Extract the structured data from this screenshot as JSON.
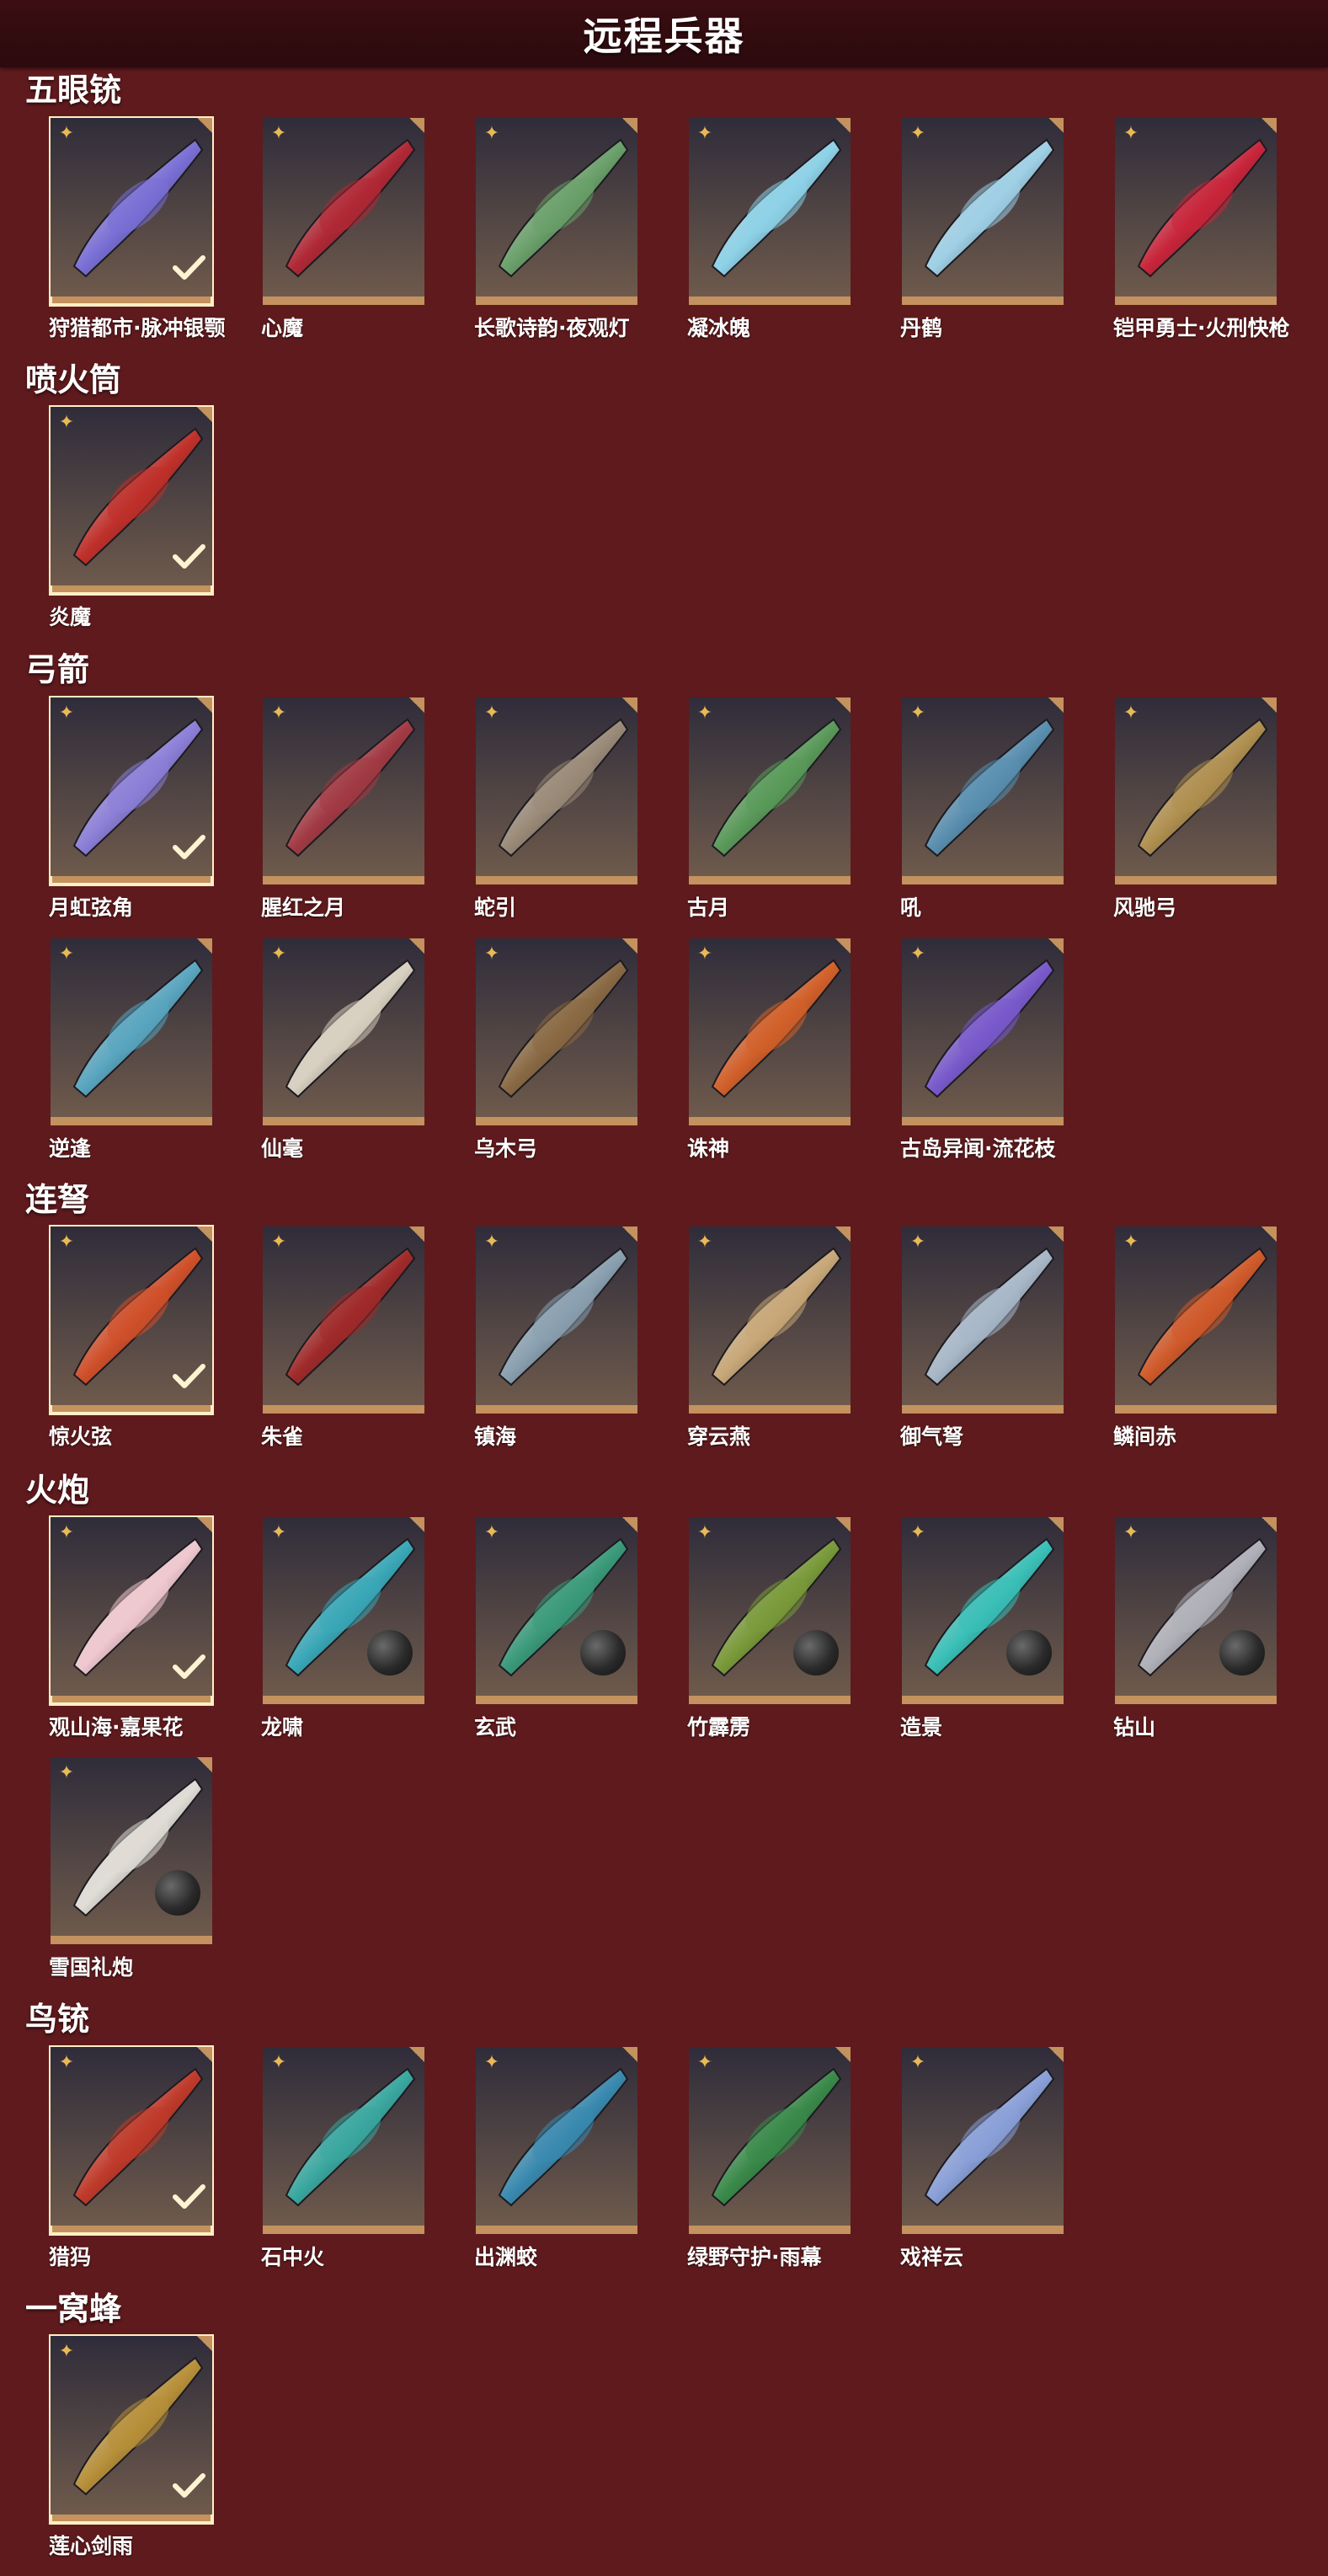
{
  "page": {
    "title": "远程兵器"
  },
  "colors": {
    "background": "#5f1a1d",
    "title_bar": "#2b0a0d",
    "card_bg": "#3c3340",
    "card_border": "#c3925e",
    "selected_outline": "#ffefc4",
    "badge": "#e8b955"
  },
  "sections": [
    {
      "title": "五眼铳",
      "items": [
        {
          "name": "狩猎都市·脉冲银颚",
          "selected": true,
          "color": "#7a6fd6"
        },
        {
          "name": "心魔",
          "selected": false,
          "color": "#b02835"
        },
        {
          "name": "长歌诗韵·夜观灯",
          "selected": false,
          "color": "#6aa06a"
        },
        {
          "name": "凝冰魄",
          "selected": false,
          "color": "#8ed2e8"
        },
        {
          "name": "丹鹤",
          "selected": false,
          "color": "#9fd0e6"
        },
        {
          "name": "铠甲勇士·火刑快枪",
          "selected": false,
          "color": "#c8253a"
        }
      ]
    },
    {
      "title": "喷火筒",
      "items": [
        {
          "name": "炎魔",
          "selected": true,
          "color": "#c0302a"
        }
      ]
    },
    {
      "title": "弓箭",
      "items": [
        {
          "name": "月虹弦角",
          "selected": true,
          "color": "#8c7fd8"
        },
        {
          "name": "腥红之月",
          "selected": false,
          "color": "#a23a44"
        },
        {
          "name": "蛇引",
          "selected": false,
          "color": "#9a8a78"
        },
        {
          "name": "古月",
          "selected": false,
          "color": "#5a9a5a"
        },
        {
          "name": "吼",
          "selected": false,
          "color": "#5a8fb0"
        },
        {
          "name": "风驰弓",
          "selected": false,
          "color": "#b09050"
        },
        {
          "name": "逆逢",
          "selected": false,
          "color": "#5aa6c0"
        },
        {
          "name": "仙毫",
          "selected": false,
          "color": "#d8d0c0"
        },
        {
          "name": "乌木弓",
          "selected": false,
          "color": "#8a6a44"
        },
        {
          "name": "诛神",
          "selected": false,
          "color": "#d2602a"
        },
        {
          "name": "古岛异闻·流花枝",
          "selected": false,
          "color": "#7a5acc"
        }
      ]
    },
    {
      "title": "连弩",
      "items": [
        {
          "name": "惊火弦",
          "selected": true,
          "color": "#d0502a"
        },
        {
          "name": "朱雀",
          "selected": false,
          "color": "#a02a2a"
        },
        {
          "name": "镇海",
          "selected": false,
          "color": "#8aa0b0"
        },
        {
          "name": "穿云燕",
          "selected": false,
          "color": "#c8a878"
        },
        {
          "name": "御气弩",
          "selected": false,
          "color": "#a8b8c8"
        },
        {
          "name": "鳞间赤",
          "selected": false,
          "color": "#d05a2a"
        }
      ]
    },
    {
      "title": "火炮",
      "items": [
        {
          "name": "观山海·嘉果花",
          "selected": true,
          "color": "#f0c8d0",
          "ball": false
        },
        {
          "name": "龙啸",
          "selected": false,
          "color": "#3aa8b8",
          "ball": true
        },
        {
          "name": "玄武",
          "selected": false,
          "color": "#3a9a7a",
          "ball": true
        },
        {
          "name": "竹霹雳",
          "selected": false,
          "color": "#7a9a3a",
          "ball": true
        },
        {
          "name": "造景",
          "selected": false,
          "color": "#3ac0b8",
          "ball": true
        },
        {
          "name": "钻山",
          "selected": false,
          "color": "#b0b0b8",
          "ball": true
        },
        {
          "name": "雪国礼炮",
          "selected": false,
          "color": "#e0dcd6",
          "ball": true
        }
      ]
    },
    {
      "title": "鸟铳",
      "items": [
        {
          "name": "猎犸",
          "selected": true,
          "color": "#c03a2a"
        },
        {
          "name": "石中火",
          "selected": false,
          "color": "#3aa8a0"
        },
        {
          "name": "出渊蛟",
          "selected": false,
          "color": "#3a8ab0"
        },
        {
          "name": "绿野守护·雨幕",
          "selected": false,
          "color": "#3a8a4a"
        },
        {
          "name": "戏祥云",
          "selected": false,
          "color": "#8aa0d8"
        }
      ]
    },
    {
      "title": "一窝蜂",
      "items": [
        {
          "name": "莲心剑雨",
          "selected": true,
          "color": "#b8903a"
        }
      ]
    }
  ]
}
